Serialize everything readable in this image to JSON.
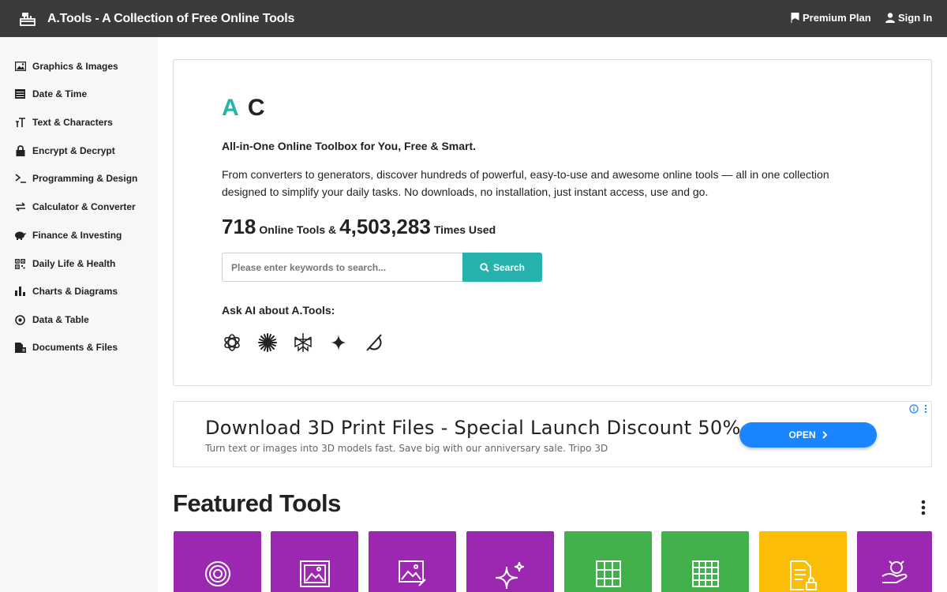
{
  "header": {
    "title": "A.Tools - A Collection of Free Online Tools",
    "premium_label": "Premium Plan",
    "signin_label": "Sign In",
    "bg_color": "#3b3b3b"
  },
  "sidebar": {
    "items": [
      {
        "label": "Graphics & Images",
        "icon": "image-icon"
      },
      {
        "label": "Date & Time",
        "icon": "calendar-icon"
      },
      {
        "label": "Text & Characters",
        "icon": "text-icon"
      },
      {
        "label": "Encrypt & Decrypt",
        "icon": "lock-icon"
      },
      {
        "label": "Programming & Design",
        "icon": "terminal-icon"
      },
      {
        "label": "Calculator & Converter",
        "icon": "exchange-icon"
      },
      {
        "label": "Finance & Investing",
        "icon": "piggy-bank-icon"
      },
      {
        "label": "Daily Life & Health",
        "icon": "qr-code-icon"
      },
      {
        "label": "Charts & Diagrams",
        "icon": "bar-chart-icon"
      },
      {
        "label": "Data & Table",
        "icon": "target-icon"
      },
      {
        "label": "Documents & Files",
        "icon": "file-icon"
      }
    ]
  },
  "hero": {
    "brand_a": "A",
    "brand_c": "C",
    "tagline": "All-in-One Online Toolbox for You, Free & Smart.",
    "description": "From converters to generators, discover hundreds of powerful, easy-to-use and awesome online tools — all in one collection designed to simplify your daily tasks. No downloads, no installation, just instant access, use and go.",
    "tool_count": "718",
    "tool_count_label": "Online Tools &",
    "usage_count": "4,503,283",
    "usage_label": "Times Used",
    "search_placeholder": "Please enter keywords to search...",
    "search_button": "Search",
    "ask_ai_label": "Ask AI about A.Tools:",
    "ai_icons": [
      "openai-icon",
      "claude-icon",
      "perplexity-icon",
      "gemini-icon",
      "grok-icon"
    ],
    "accent_color": "#26b3ad"
  },
  "ad": {
    "title": "Download 3D Print Files - Special Launch Discount 50%",
    "subtitle": "Turn text or images into 3D models fast. Save big with our anniversary sale. Tripo 3D",
    "button": "OPEN"
  },
  "featured": {
    "title": "Featured Tools",
    "tiles": [
      {
        "color": "#9c27b0",
        "icon": "spiral-icon"
      },
      {
        "color": "#9c27b0",
        "icon": "image-frame-icon"
      },
      {
        "color": "#9c27b0",
        "icon": "image-edit-icon"
      },
      {
        "color": "#9c27b0",
        "icon": "sparkle-icon"
      },
      {
        "color": "#43b14b",
        "icon": "sudoku-icon"
      },
      {
        "color": "#43b14b",
        "icon": "grid-icon"
      },
      {
        "color": "#fbbd08",
        "icon": "document-lock-icon"
      },
      {
        "color": "#9c27b0",
        "icon": "hand-pig-icon"
      }
    ]
  }
}
